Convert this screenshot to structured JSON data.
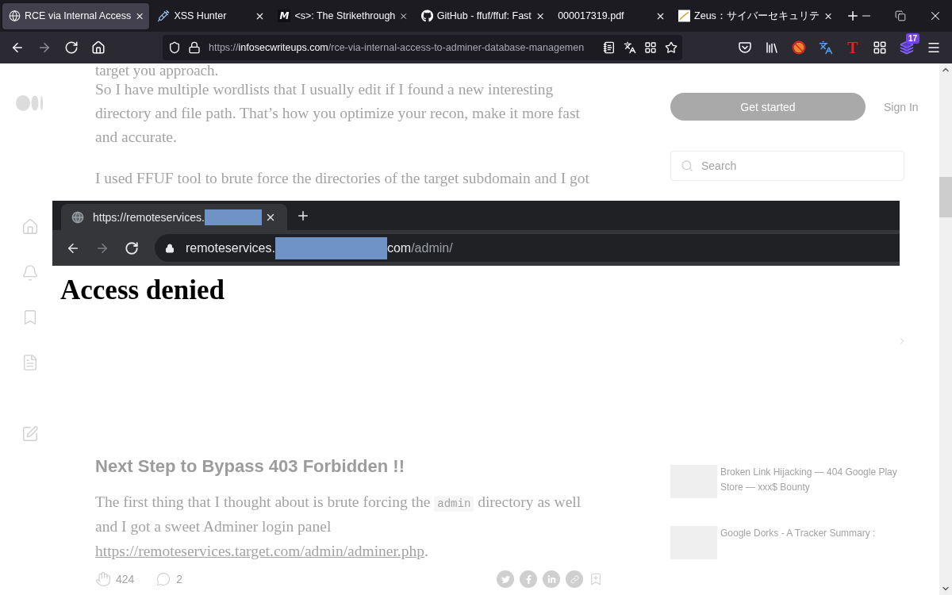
{
  "tabs": [
    {
      "title": "RCE via Internal Access",
      "kind": "globe",
      "selected": true
    },
    {
      "title": "XSS Hunter",
      "kind": "syringe",
      "selected": false
    },
    {
      "title": "<s>: The Strikethrough",
      "kind": "letter",
      "icon_letter": "M",
      "selected": false
    },
    {
      "title": "GitHub - ffuf/ffuf: Fast",
      "kind": "github",
      "selected": false
    },
    {
      "title": "000017319.pdf",
      "kind": "plain",
      "selected": false
    },
    {
      "title": "Zeus：サイバーセキュリテ",
      "kind": "picture",
      "selected": false
    }
  ],
  "navigation": {
    "back_disabled": false,
    "forward_disabled": true
  },
  "address_bar": {
    "scheme": "https://",
    "host": "infosecwriteups.com",
    "path": "/rce-via-internal-access-to-adminer-database-managemen"
  },
  "toolbar": {
    "extension_letter": "T",
    "extension_badge": "17"
  },
  "article": {
    "cut_line": "target you approach.",
    "paragraph_1": "So I have multiple wordlists that I usually edit if I found a new interesting directory and file path. That’s how you optimize your recon, make it more fast and accurate.",
    "paragraph_2": "I used FFUF tool to brute force the directories of the target subdomain and I got",
    "heading": "Next Step to Bypass 403 Forbidden !!",
    "paragraph_3": {
      "before": "The first thing that I thought about is brute forcing the",
      "code": "admin",
      "after": "directory as well and I got a sweet Adminer login panel",
      "link": "https://remoteservices.target.com/admin/adminer.php",
      "end": "."
    }
  },
  "footer": {
    "claps": "424",
    "responses": "2"
  },
  "sidebar": {
    "get_started": "Get started",
    "sign_in": "Sign In",
    "search": {
      "placeholder": "Search"
    },
    "stories": [
      {
        "title": "Broken Link Hijacking — 404 Google Play Store — xxx$ Bounty"
      },
      {
        "title": "Google Dorks - A Tracker Summary :"
      }
    ]
  },
  "image_overlay": {
    "tab_title": "https://remoteservices.",
    "url_host": "remoteservices.",
    "url_domain_end": "com",
    "url_path": "/admin/",
    "forward_disabled": true,
    "heading": "Access denied"
  }
}
